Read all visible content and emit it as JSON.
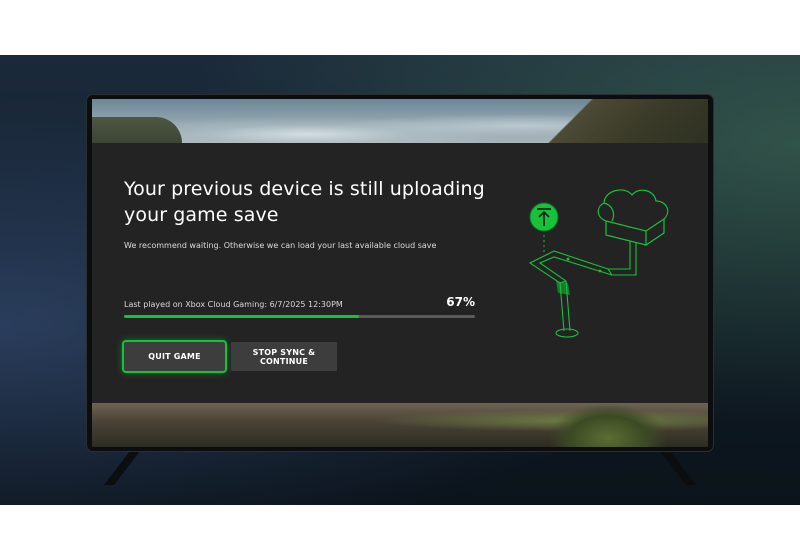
{
  "dialog": {
    "title": "Your previous device is still uploading your game save",
    "subtitle": "We recommend waiting. Otherwise we can load your last available cloud save",
    "last_played": "Last played on Xbox Cloud Gaming: 6/7/2025 12:30PM",
    "progress": {
      "percent_label": "67%",
      "fraction": 0.67
    },
    "buttons": {
      "quit_label": "QUIT GAME",
      "stop_sync_label": "STOP SYNC & CONTINUE"
    }
  },
  "illustration": {
    "icons": [
      "upload-icon",
      "cloud-icon"
    ]
  },
  "colors": {
    "accent_green": "#16c13b",
    "dialog_bg": "#232323",
    "button_bg": "#3d3d3d",
    "track_bg": "#5a5a5a"
  }
}
